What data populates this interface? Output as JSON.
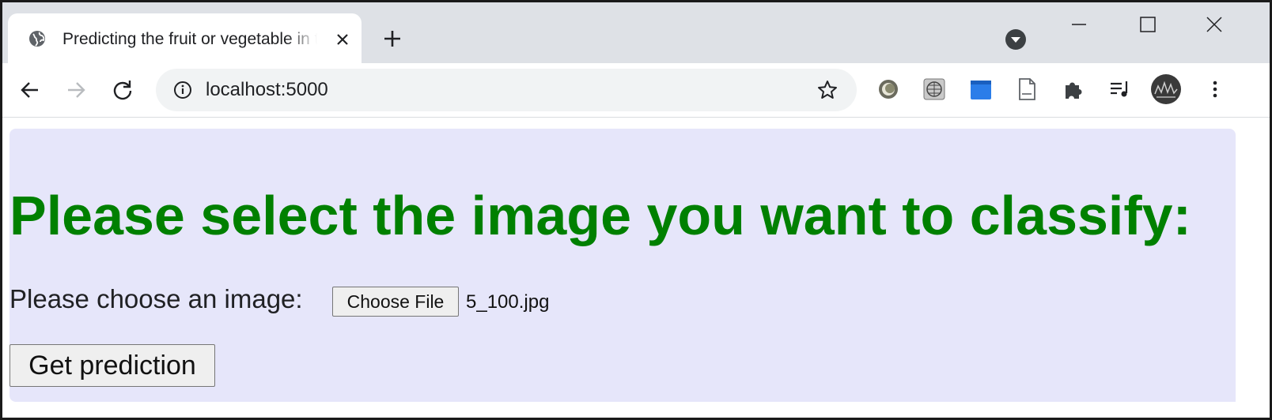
{
  "browser": {
    "tab_title": "Predicting the fruit or vegetable in the image",
    "url": "localhost:5000"
  },
  "page": {
    "heading": "Please select the image you want to classify:",
    "choose_label": "Please choose an image:",
    "file_button_label": "Choose File",
    "selected_file": "5_100.jpg",
    "submit_label": "Get prediction"
  },
  "colors": {
    "heading": "#008000",
    "page_background": "#e6e6fa",
    "tabstrip": "#dee1e6",
    "omnibox": "#f1f3f4"
  }
}
